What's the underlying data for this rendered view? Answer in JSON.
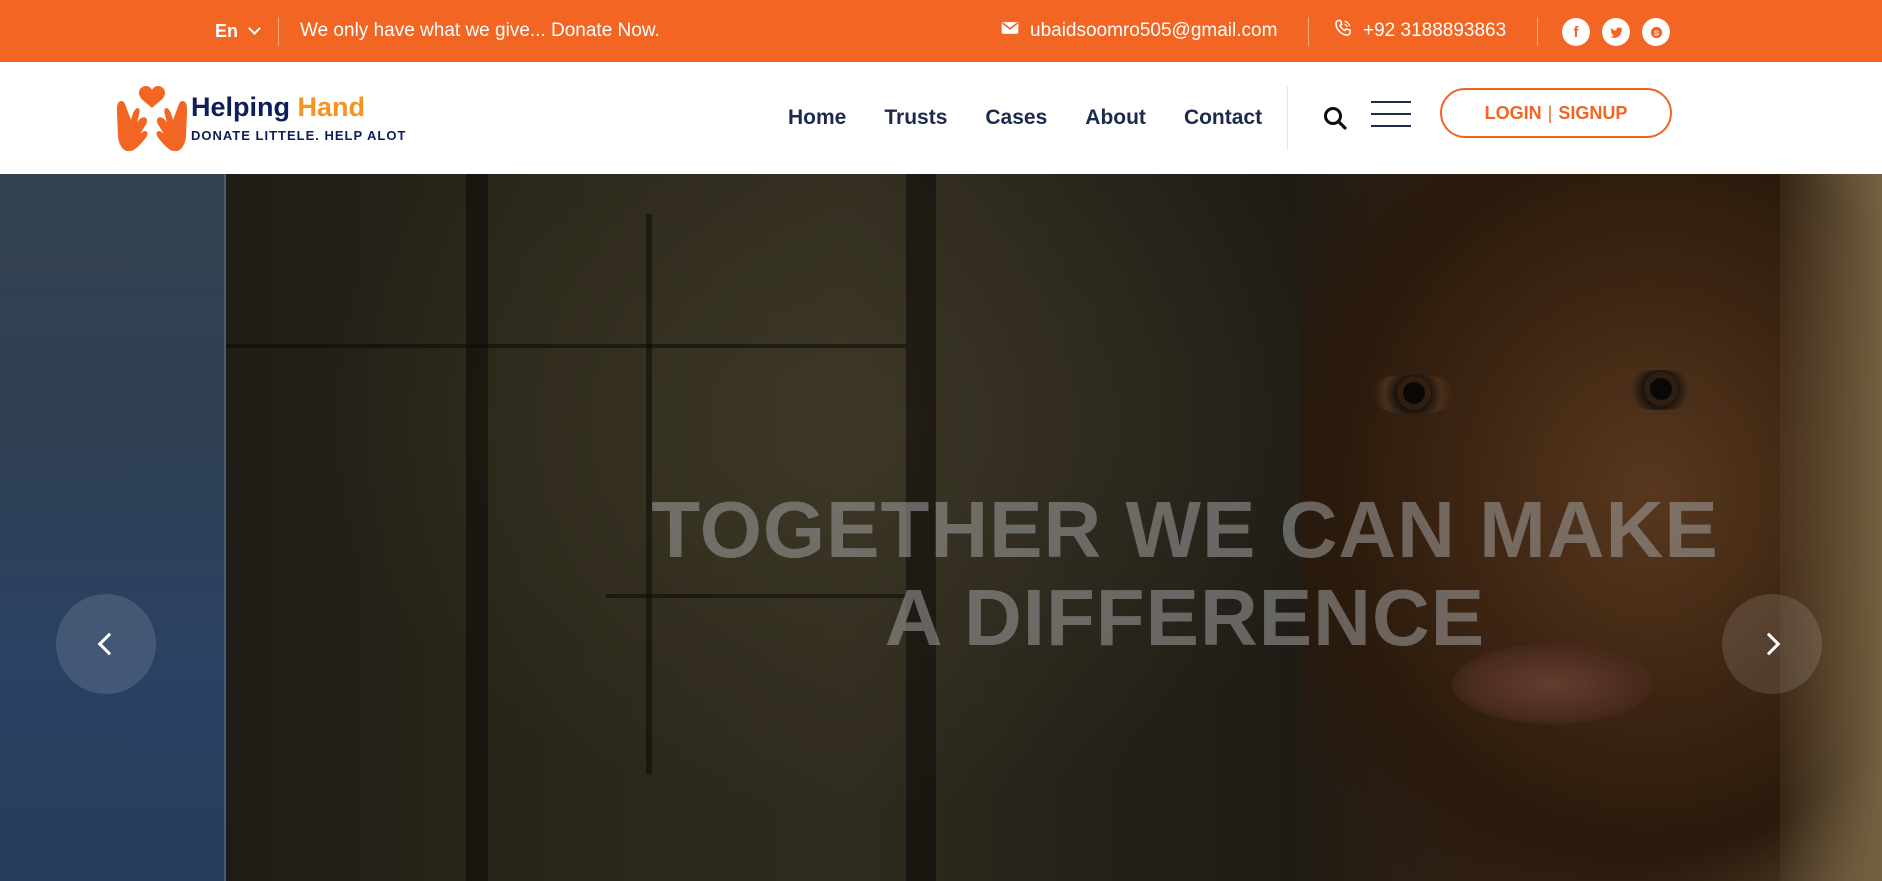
{
  "topbar": {
    "language": "En",
    "tagline": "We only have what we give... Donate Now.",
    "email": "ubaidsoomro505@gmail.com",
    "phone": "+92 3188893863",
    "socials": [
      {
        "name": "facebook",
        "icon": "facebook-icon",
        "glyph": "f"
      },
      {
        "name": "twitter",
        "icon": "twitter-icon",
        "glyph": ""
      },
      {
        "name": "skype",
        "icon": "skype-icon",
        "glyph": "S"
      }
    ],
    "background_color": "#f26522"
  },
  "header": {
    "brand": {
      "name_primary": "Helping",
      "name_secondary": "Hand",
      "tagline": "DONATE LITTELE. HELP ALOT"
    },
    "nav": [
      "Home",
      "Trusts",
      "Cases",
      "About",
      "Contact"
    ],
    "auth": {
      "login": "LOGIN",
      "separator": "|",
      "signup": "SIGNUP"
    },
    "icons": [
      "search-icon",
      "hamburger-menu-icon"
    ],
    "accent_color": "#f26522",
    "nav_color": "#1c2a4f"
  },
  "hero": {
    "title_line1": "TOGETHER WE CAN MAKE",
    "title_line2": "A DIFFERENCE",
    "controls": [
      "chevron-left-icon",
      "chevron-right-icon"
    ]
  }
}
